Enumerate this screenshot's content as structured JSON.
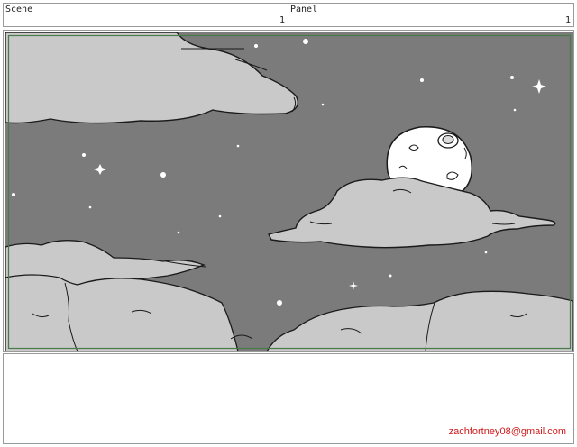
{
  "header": {
    "scene_label": "Scene",
    "scene_number": "1",
    "panel_label": "Panel",
    "panel_number": "1"
  },
  "panel_art": {
    "sky_color": "#7b7b7b",
    "cloud_color": "#c9c9c9",
    "line_color": "#1a1a1a",
    "border_color": "#4a7a4a"
  },
  "footer": {
    "credit": "zachfortney08@gmail.com",
    "credit_color": "#d01818"
  }
}
